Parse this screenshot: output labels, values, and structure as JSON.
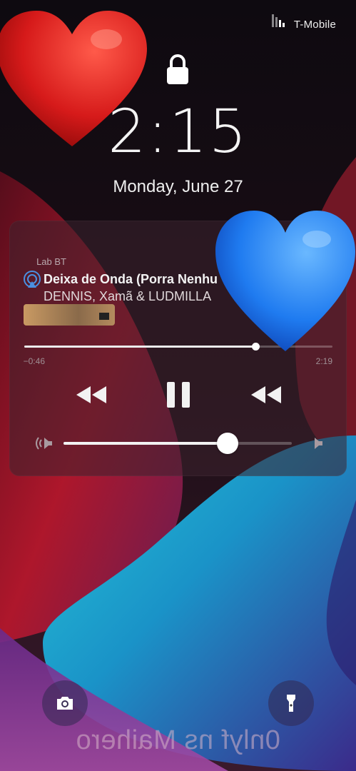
{
  "status_bar": {
    "carrier": "T-Mobile",
    "signal_icon": "signal-bars-icon"
  },
  "lock": {
    "icon": "lock-icon",
    "time": "2:15",
    "date": "Monday, June 27"
  },
  "now_playing": {
    "source": "Lab BT",
    "title": "Deixa de Onda (Porra Nenhuma)",
    "artist": "DENNIS, Xamã & LUDMILLA",
    "elapsed": "2:19",
    "remaining": "−0:46",
    "progress": 0.75,
    "volume": 0.72,
    "icons": {
      "airplay": "airplay-icon",
      "previous": "previous-track-icon",
      "pause": "pause-icon",
      "next": "next-track-icon",
      "volume_low": "volume-low-icon",
      "volume_high": "volume-high-icon"
    }
  },
  "quick_actions": {
    "flashlight": "flashlight-icon",
    "camera": "camera-icon"
  },
  "overlay": {
    "caption": "0nlyf ns Maihero",
    "stickers": [
      "red-heart-emoji",
      "blue-heart-emoji"
    ]
  },
  "colors": {
    "red_heart": "#d61a1a",
    "blue_heart": "#1f7bf0",
    "accent": "#ffffff"
  }
}
